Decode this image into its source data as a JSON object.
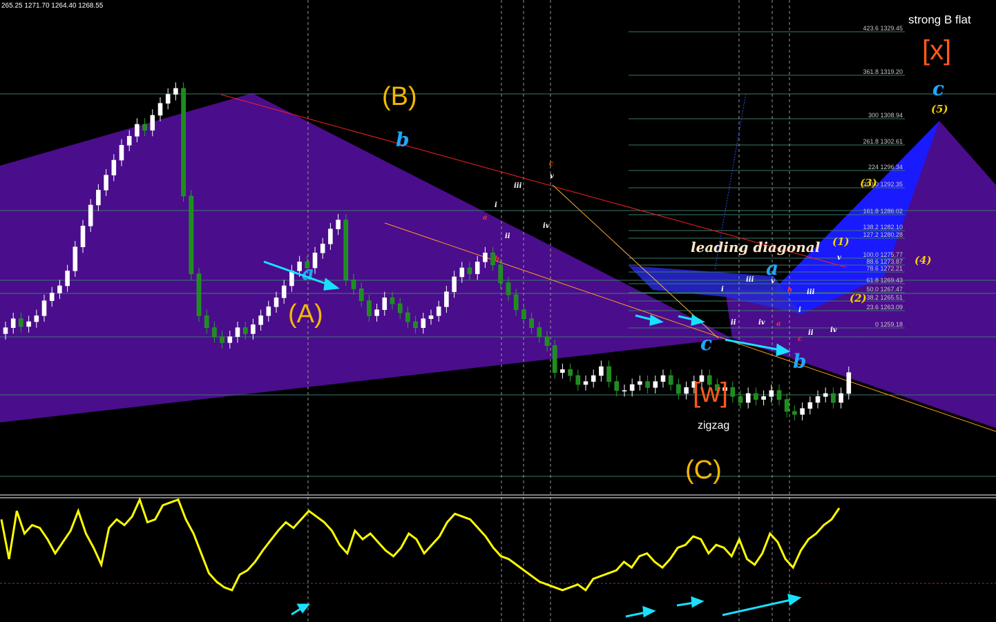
{
  "header": {
    "ohlc": "265.25 1271.70 1264.40 1268.55"
  },
  "colors": {
    "background": "#000000",
    "pattern_fill": "#4a0d8c",
    "blue_wedge": "#1a1aff",
    "bull_candle": "#ffffff",
    "bear_candle": "#1e8c1e",
    "oscillator": "#ffff00",
    "arrow": "#19e0ff",
    "trendline_red": "#ff2020",
    "trendline_orange": "#ff9a20"
  },
  "labels": {
    "wave_B_main": "(B)",
    "wave_A_main": "(A)",
    "wave_C_main": "(C)",
    "wave_b_1": "b",
    "wave_a_1": "a",
    "wave_c_1": "c",
    "wave_b_2": "b",
    "wave_a_2": "a",
    "wave_c_2": "c",
    "wave_w": "[w]",
    "wave_x": "[x]",
    "zigzag": "zigzag",
    "strong_b_flat": "strong B flat",
    "leading_diagonal": "leading diagonal",
    "wave_1": "(1)",
    "wave_2": "(2)",
    "wave_3": "(3)",
    "wave_4": "(4)",
    "wave_5": "(5)"
  },
  "small_labels": [
    {
      "text": "c",
      "color": "#ff5a1a"
    },
    {
      "text": "v",
      "color": "#ffffff"
    },
    {
      "text": "iii",
      "color": "#ffffff"
    },
    {
      "text": "i",
      "color": "#ffffff"
    },
    {
      "text": "a",
      "color": "#ff3030"
    },
    {
      "text": "ii",
      "color": "#ffffff"
    },
    {
      "text": "b",
      "color": "#ff3030"
    },
    {
      "text": "iv",
      "color": "#ffffff"
    },
    {
      "text": "i",
      "color": "#ffffff"
    },
    {
      "text": "iii",
      "color": "#ffffff"
    },
    {
      "text": "v",
      "color": "#ffffff"
    },
    {
      "text": "ii",
      "color": "#ffffff"
    },
    {
      "text": "iv",
      "color": "#ffffff"
    },
    {
      "text": "a",
      "color": "#ff3030"
    },
    {
      "text": "b",
      "color": "#ff3030"
    },
    {
      "text": "i",
      "color": "#ffffff"
    },
    {
      "text": "iii",
      "color": "#ffffff"
    },
    {
      "text": "ii",
      "color": "#ffffff"
    },
    {
      "text": "c",
      "color": "#ff3030"
    },
    {
      "text": "iv",
      "color": "#ffffff"
    },
    {
      "text": "v",
      "color": "#ffffff"
    }
  ],
  "chart_data": {
    "type": "candlestick",
    "title": "",
    "fib_levels": [
      {
        "ratio": "423.6",
        "price": "1329.45"
      },
      {
        "ratio": "361.8",
        "price": "1319.20"
      },
      {
        "ratio": "300",
        "price": "1308.94"
      },
      {
        "ratio": "261.8",
        "price": "1302.61"
      },
      {
        "ratio": "224",
        "price": "1296.34"
      },
      {
        "ratio": "200.0",
        "price": "1292.35"
      },
      {
        "ratio": "161.8",
        "price": "1286.02"
      },
      {
        "ratio": "138.2",
        "price": "1282.10"
      },
      {
        "ratio": "127.2",
        "price": "1280.28"
      },
      {
        "ratio": "100.0",
        "price": "1275.77"
      },
      {
        "ratio": "88.6",
        "price": "1273.87"
      },
      {
        "ratio": "78.6",
        "price": "1272.21"
      },
      {
        "ratio": "61.8",
        "price": "1269.43"
      },
      {
        "ratio": "50.0",
        "price": "1267.47"
      },
      {
        "ratio": "38.2",
        "price": "1265.51"
      },
      {
        "ratio": "23.6",
        "price": "1263.09"
      },
      {
        "ratio": "0",
        "price": "1259.18"
      }
    ],
    "closes": [
      1266.0,
      1267.5,
      1266.2,
      1267.0,
      1268.0,
      1270.5,
      1271.8,
      1273.0,
      1275.5,
      1279.5,
      1283.0,
      1286.5,
      1289.0,
      1291.5,
      1294.0,
      1296.5,
      1298.0,
      1300.0,
      1299.0,
      1301.5,
      1303.5,
      1305.0,
      1306.0,
      1288.0,
      1275.0,
      1268.0,
      1266.0,
      1264.5,
      1263.5,
      1264.5,
      1266.0,
      1265.0,
      1266.5,
      1268.0,
      1269.5,
      1271.0,
      1273.0,
      1275.5,
      1277.0,
      1276.0,
      1278.5,
      1280.0,
      1282.5,
      1284.0,
      1274.0,
      1272.5,
      1270.5,
      1268.0,
      1269.0,
      1271.0,
      1270.0,
      1268.5,
      1267.0,
      1266.0,
      1267.5,
      1268.0,
      1269.5,
      1272.0,
      1274.5,
      1276.0,
      1275.0,
      1277.0,
      1278.5,
      1276.5,
      1273.5,
      1271.5,
      1269.0,
      1267.5,
      1266.0,
      1264.5,
      1263.0,
      1258.5,
      1259.0,
      1258.0,
      1256.5,
      1257.0,
      1258.0,
      1259.5,
      1257.0,
      1255.5,
      1255.5,
      1256.5,
      1257.0,
      1256.0,
      1257.0,
      1258.0,
      1256.5,
      1255.0,
      1256.0,
      1257.0,
      1258.0,
      1256.5,
      1255.5,
      1256.0,
      1254.5,
      1253.5,
      1255.0,
      1254.0,
      1254.5,
      1255.5,
      1254.0,
      1252.0,
      1251.5,
      1252.5,
      1253.5,
      1254.5,
      1255.0,
      1253.5,
      1255.0,
      1258.5
    ],
    "oscillator": [
      0.72,
      0.44,
      0.78,
      0.62,
      0.68,
      0.66,
      0.58,
      0.48,
      0.56,
      0.64,
      0.78,
      0.62,
      0.52,
      0.4,
      0.66,
      0.72,
      0.68,
      0.74,
      0.86,
      0.7,
      0.72,
      0.82,
      0.84,
      0.86,
      0.72,
      0.62,
      0.48,
      0.34,
      0.28,
      0.24,
      0.22,
      0.33,
      0.36,
      0.42,
      0.5,
      0.57,
      0.64,
      0.7,
      0.66,
      0.72,
      0.78,
      0.74,
      0.7,
      0.64,
      0.54,
      0.48,
      0.64,
      0.58,
      0.62,
      0.56,
      0.5,
      0.46,
      0.52,
      0.62,
      0.58,
      0.48,
      0.54,
      0.6,
      0.7,
      0.76,
      0.74,
      0.72,
      0.66,
      0.6,
      0.52,
      0.46,
      0.44,
      0.4,
      0.36,
      0.32,
      0.28,
      0.26,
      0.24,
      0.22,
      0.24,
      0.26,
      0.22,
      0.3,
      0.32,
      0.34,
      0.36,
      0.42,
      0.38,
      0.46,
      0.48,
      0.42,
      0.38,
      0.44,
      0.52,
      0.54,
      0.6,
      0.58,
      0.48,
      0.54,
      0.52,
      0.46,
      0.58,
      0.44,
      0.4,
      0.48,
      0.62,
      0.56,
      0.44,
      0.38,
      0.5,
      0.58,
      0.62,
      0.68,
      0.72,
      0.8
    ]
  }
}
